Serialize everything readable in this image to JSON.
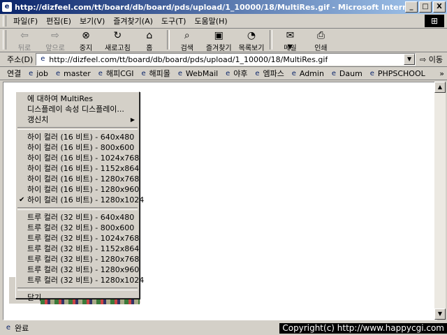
{
  "window": {
    "title": "http://dizfeel.com/tt/board/db/board/pds/upload/1_10000/18/MultiRes.gif - Microsoft Internet Explorer",
    "minimize": "_",
    "maximize": "□",
    "close": "X"
  },
  "menubar": {
    "items": [
      "파일(F)",
      "편집(E)",
      "보기(V)",
      "즐겨찾기(A)",
      "도구(T)",
      "도움말(H)"
    ]
  },
  "toolbar": {
    "back": "뒤로",
    "forward": "앞으로",
    "stop": "중지",
    "refresh": "새로고침",
    "home": "홈",
    "search": "검색",
    "favorites": "즐겨찾기",
    "history": "목록보기",
    "mail": "메일",
    "print": "인쇄"
  },
  "address": {
    "label": "주소(D)",
    "url": "http://dizfeel.com/tt/board/db/board/pds/upload/1_10000/18/MultiRes.gif",
    "go": "이동"
  },
  "links": {
    "label": "연결",
    "items": [
      "job",
      "master",
      "해피CGI",
      "해피몰",
      "WebMail",
      "야후",
      "엠파스",
      "Admin",
      "Daum",
      "PHPSCHOOL"
    ],
    "more": "»"
  },
  "context_menu": {
    "about": "에 대하여 MultiRes",
    "display_props": "디스플레이 속성 디스플레이...",
    "refresh": "갱신치",
    "high_color": [
      "하이 컬러 (16 비트) - 640x480",
      "하이 컬러 (16 비트) - 800x600",
      "하이 컬러 (16 비트) - 1024x768",
      "하이 컬러 (16 비트) - 1152x864",
      "하이 컬러 (16 비트) - 1280x768",
      "하이 컬러 (16 비트) - 1280x960",
      "하이 컬러 (16 비트) - 1280x1024"
    ],
    "true_color": [
      "트루 컬러 (32 비트) - 640x480",
      "트루 컬러 (32 비트) - 800x600",
      "트루 컬러 (32 비트) - 1024x768",
      "트루 컬러 (32 비트) - 1152x864",
      "트루 컬러 (32 비트) - 1280x768",
      "트루 컬러 (32 비트) - 1280x960",
      "트루 컬러 (32 비트) - 1280x1024"
    ],
    "close": "닫기"
  },
  "status": {
    "text": "완료",
    "copyright": "Copyright(c) http://www.happycgi.com"
  }
}
